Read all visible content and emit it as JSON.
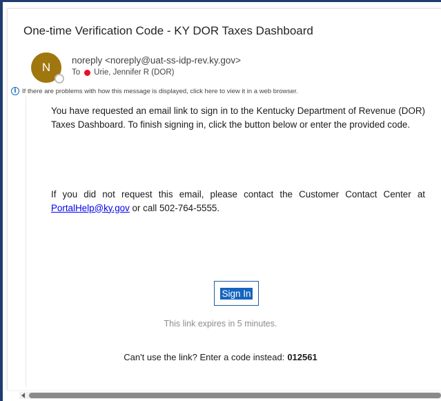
{
  "email": {
    "subject": "One-time Verification Code - KY DOR Taxes Dashboard",
    "avatar_initial": "N",
    "sender": "noreply <noreply@uat-ss-idp-rev.ky.gov>",
    "to_label": "To",
    "to_recipient": "Urie, Jennifer R (DOR)",
    "display_notice": "If there are problems with how this message is displayed, click here to view it in a web browser."
  },
  "message": {
    "paragraph1": "You have requested an email link to sign in to the Kentucky Department of Revenue (DOR) Taxes Dashboard. To finish signing in, click the button below or enter the provided code.",
    "paragraph2_prefix": "If you did not request this email, please contact the Customer Contact Center at ",
    "support_email": "PortalHelp@ky.gov",
    "paragraph2_suffix": " or call 502-764-5555.",
    "signin_label": "Sign In",
    "expires_text": "This link expires in 5 minutes.",
    "code_prompt": "Can't use the link? Enter a code instead:",
    "code": "012561"
  },
  "colors": {
    "avatar": "#a0760f",
    "presence_busy": "#e81123",
    "link": "#0000ee",
    "button": "#1565c0",
    "frame": "#1f3d6e"
  },
  "icons": [
    "info-icon",
    "presence-status-icon",
    "scroll-left-arrow-icon"
  ]
}
